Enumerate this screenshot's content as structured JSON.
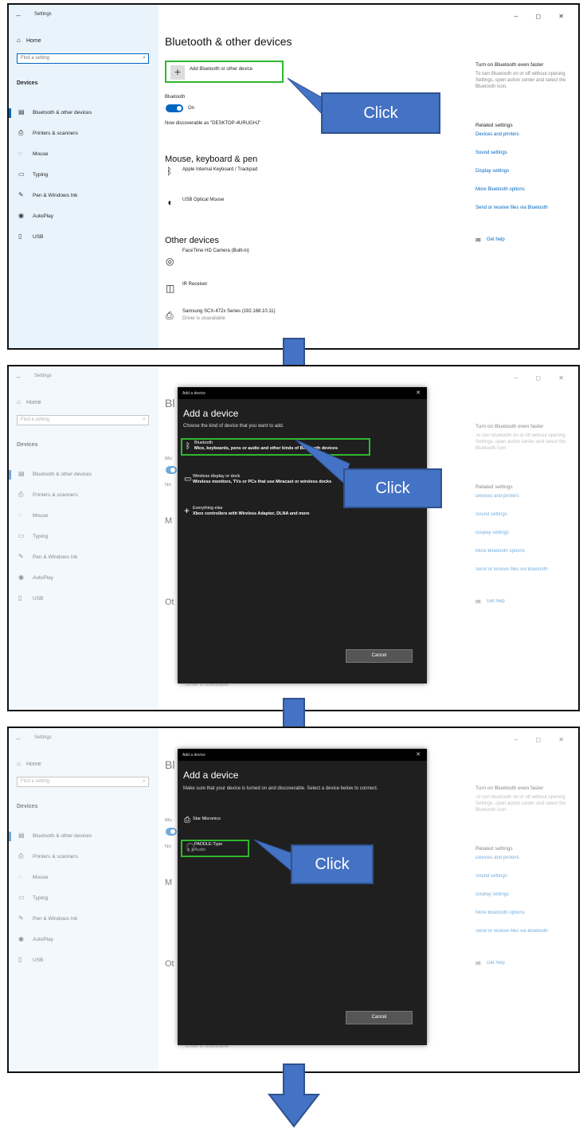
{
  "settings": {
    "window_title": "Settings",
    "home_label": "Home",
    "search_placeholder": "Find a setting",
    "devices_header": "Devices",
    "nav_items": [
      {
        "label": "Bluetooth & other devices",
        "icon": "bluetooth-devices-icon"
      },
      {
        "label": "Printers & scanners",
        "icon": "printer-icon"
      },
      {
        "label": "Mouse",
        "icon": "mouse-icon"
      },
      {
        "label": "Typing",
        "icon": "keyboard-icon"
      },
      {
        "label": "Pen & Windows Ink",
        "icon": "pen-icon"
      },
      {
        "label": "AutoPlay",
        "icon": "autoplay-icon"
      },
      {
        "label": "USB",
        "icon": "usb-icon"
      }
    ],
    "page_title": "Bluetooth & other devices",
    "page_title_short": "Bl",
    "add_device_label": "Add Bluetooth or other device",
    "bluetooth_label": "Bluetooth",
    "bluetooth_short": "Blu",
    "toggle_state": "On",
    "discoverable_text": "Now discoverable as \"DESKTOP-4URUGHJ\"",
    "discoverable_short": "No",
    "mouse_section": "Mouse, keyboard & pen",
    "mouse_section_short": "M",
    "mouse_devices": [
      {
        "name": "Apple Internal Keyboard / Trackpad",
        "icon": "bluetooth-icon"
      },
      {
        "name": "USB Optical Mouse",
        "icon": "mouse-icon"
      }
    ],
    "other_section": "Other devices",
    "other_section_short": "Ot",
    "other_devices": [
      {
        "name": "FaceTime HD Camera (Built-in)",
        "sub": "",
        "icon": "camera-icon"
      },
      {
        "name": "IR Receiver",
        "sub": "",
        "icon": "ir-receiver-icon"
      },
      {
        "name": "Samsung SCX-472x Series (192.168.10.11)",
        "sub": "Driver is unavailable",
        "icon": "printer-icon"
      }
    ],
    "right_panel": {
      "faster_title": "Turn on Bluetooth even faster",
      "faster_text": "To turn Bluetooth on or off without opening Settings, open action center and select the Bluetooth icon.",
      "related_title": "Related settings",
      "links": [
        "Devices and printers",
        "Sound settings",
        "Display settings",
        "More Bluetooth options",
        "Send or receive files via Bluetooth"
      ],
      "help": "Get help"
    }
  },
  "dialog1": {
    "titlebar": "Add a device",
    "heading": "Add a device",
    "description": "Choose the kind of device that you want to add.",
    "options": [
      {
        "title": "Bluetooth",
        "sub": "Mice, keyboards, pens or audio and other kinds of Bluetooth devices",
        "icon": "bluetooth-icon"
      },
      {
        "title": "Wireless display or dock",
        "sub": "Wireless monitors, TVs or PCs that use Miracast or wireless docks",
        "icon": "monitor-icon"
      },
      {
        "title": "Everything else",
        "sub": "Xbox controllers with Wireless Adaptor, DLNA and more",
        "icon": "plus-icon"
      }
    ],
    "cancel": "Cancel"
  },
  "dialog2": {
    "titlebar": "Add a device",
    "heading": "Add a device",
    "description": "Make sure that your device is turned on and discoverable. Select a device below to connect.",
    "devices": [
      {
        "name": "Star Micronics",
        "sub": "",
        "icon": "printer-icon"
      },
      {
        "name": "PADDLE-Type",
        "sub": "Audio",
        "icon": "headphones-icon"
      }
    ],
    "cancel": "Cancel"
  },
  "callout_label": "Click",
  "colors": {
    "accent": "#0067c0",
    "callout": "#4472c4",
    "highlight": "#2eb82e",
    "sidebar": "#e9f3fb",
    "dialog": "#1f1f1f"
  }
}
